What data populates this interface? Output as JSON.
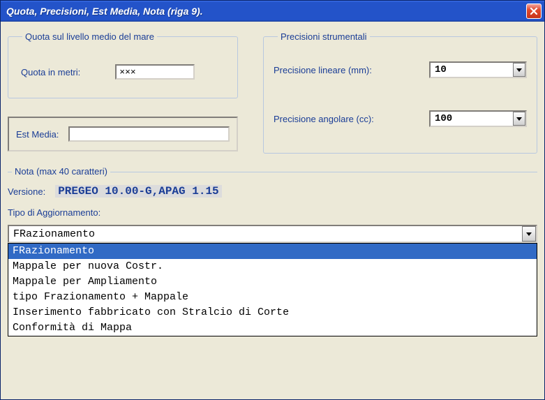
{
  "title": "Quota, Precisioni, Est Media, Nota  (riga 9).",
  "groups": {
    "quota": {
      "legend": "Quota sul livello medio del mare",
      "label": "Quota in metri:",
      "value": "×××"
    },
    "est_media": {
      "label": "Est Media:",
      "value": ""
    },
    "precisioni": {
      "legend": "Precisioni strumentali",
      "lineare_label": "Precisione lineare (mm):",
      "lineare_value": "10",
      "angolare_label": "Precisione  angolare (cc):",
      "angolare_value": "100"
    }
  },
  "nota": {
    "legend": "Nota (max 40 caratteri)",
    "versione_label": "Versione:",
    "versione_value": "PREGEO 10.00-G,APAG 1.15",
    "tipo_label": "Tipo di Aggiornamento:",
    "tipo_value": "FRazionamento",
    "options": [
      "FRazionamento",
      "Mappale per nuova Costr.",
      "Mappale per Ampliamento",
      "tipo Frazionamento + Mappale",
      "Inserimento fabbricato con Stralcio di Corte",
      "Conformità di Mappa"
    ],
    "selected_index": 0
  }
}
